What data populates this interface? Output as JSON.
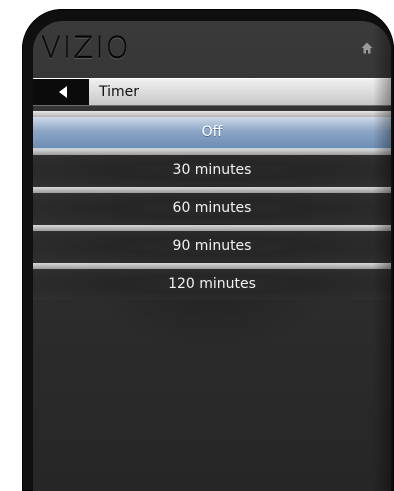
{
  "brand": {
    "logo_text": "VIZIO"
  },
  "icons": {
    "home": "home-icon",
    "back": "back-arrow-icon"
  },
  "header": {
    "title": "Timer"
  },
  "menu": {
    "selected_index": 0,
    "items": [
      {
        "label": "Off"
      },
      {
        "label": "30 minutes"
      },
      {
        "label": "60 minutes"
      },
      {
        "label": "90 minutes"
      },
      {
        "label": "120 minutes"
      }
    ]
  },
  "colors": {
    "selected_highlight": "#8da6c5",
    "screen_background": "#2c2c2c",
    "title_bar": "#d8d8d8"
  }
}
